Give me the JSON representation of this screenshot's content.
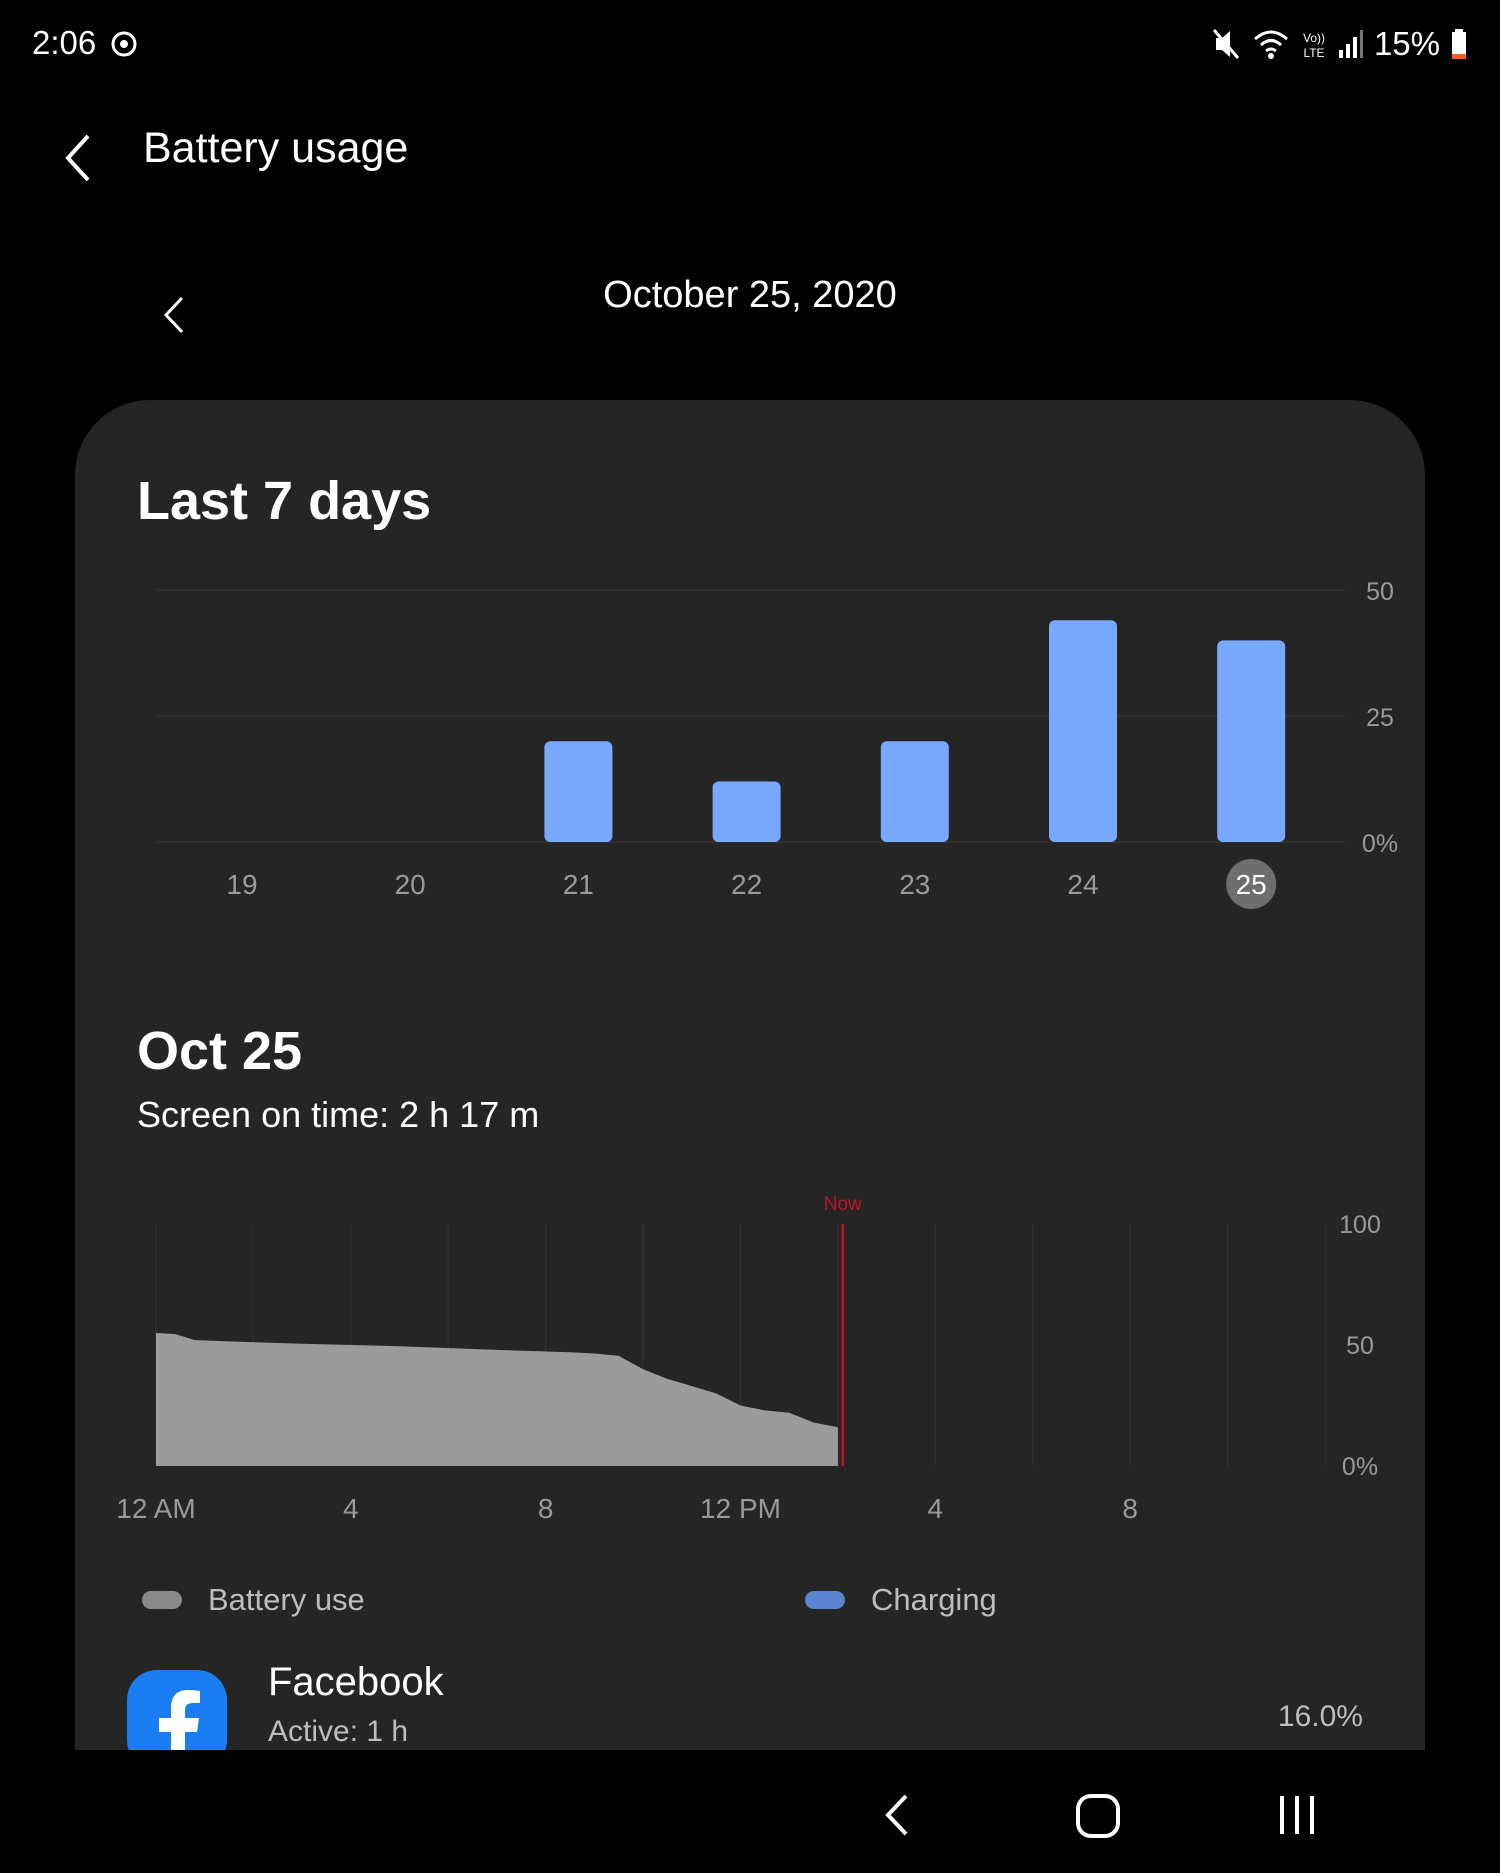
{
  "status_bar": {
    "time": "2:06",
    "battery": "15%",
    "icons": [
      "sync-icon",
      "mute-vibrate-icon",
      "wifi-icon",
      "volte-icon",
      "signal-icon",
      "battery-icon"
    ]
  },
  "app_bar": {
    "title": "Battery usage"
  },
  "date_nav": {
    "label": "October 25, 2020"
  },
  "weekly": {
    "title": "Last 7 days"
  },
  "daily": {
    "title": "Oct 25",
    "screen_on": "Screen on time: 2 h 17 m",
    "now_label": "Now"
  },
  "legend": {
    "battery_use": "Battery use",
    "charging": "Charging"
  },
  "apps": [
    {
      "name": "Facebook",
      "active": "Active: 1 h",
      "percent": "16.0%"
    }
  ],
  "colors": {
    "bar": "#78a8ff",
    "battery_area": "#9b9b9b",
    "charging": "#5a84d0",
    "now_line": "#c0152a",
    "selected_day_bg": "#6e6e6e"
  },
  "chart_data": [
    {
      "type": "bar",
      "categories": [
        "19",
        "20",
        "21",
        "22",
        "23",
        "24",
        "25"
      ],
      "values": [
        0,
        0,
        20,
        12,
        20,
        44,
        40
      ],
      "selected": "25",
      "yticks": [
        "0%",
        "25",
        "50"
      ],
      "ylim": [
        0,
        50
      ],
      "grid": true
    },
    {
      "type": "area",
      "xticks": [
        "12 AM",
        "4",
        "8",
        "12 PM",
        "4",
        "8"
      ],
      "yticks": [
        "0%",
        "50",
        "100"
      ],
      "ylim": [
        0,
        100
      ],
      "xlim": [
        0,
        24
      ],
      "x": [
        0,
        0.4,
        0.8,
        1.5,
        3,
        5,
        7,
        8.5,
        9,
        9.5,
        10,
        10.5,
        11,
        11.5,
        12,
        12.5,
        13,
        13.5,
        14
      ],
      "y": [
        55,
        54.5,
        52,
        51.5,
        50.5,
        49.5,
        48,
        47,
        46.5,
        45.5,
        40,
        36,
        33,
        30,
        25,
        23,
        22,
        18,
        16
      ],
      "now": 14.1,
      "grid": true
    }
  ]
}
